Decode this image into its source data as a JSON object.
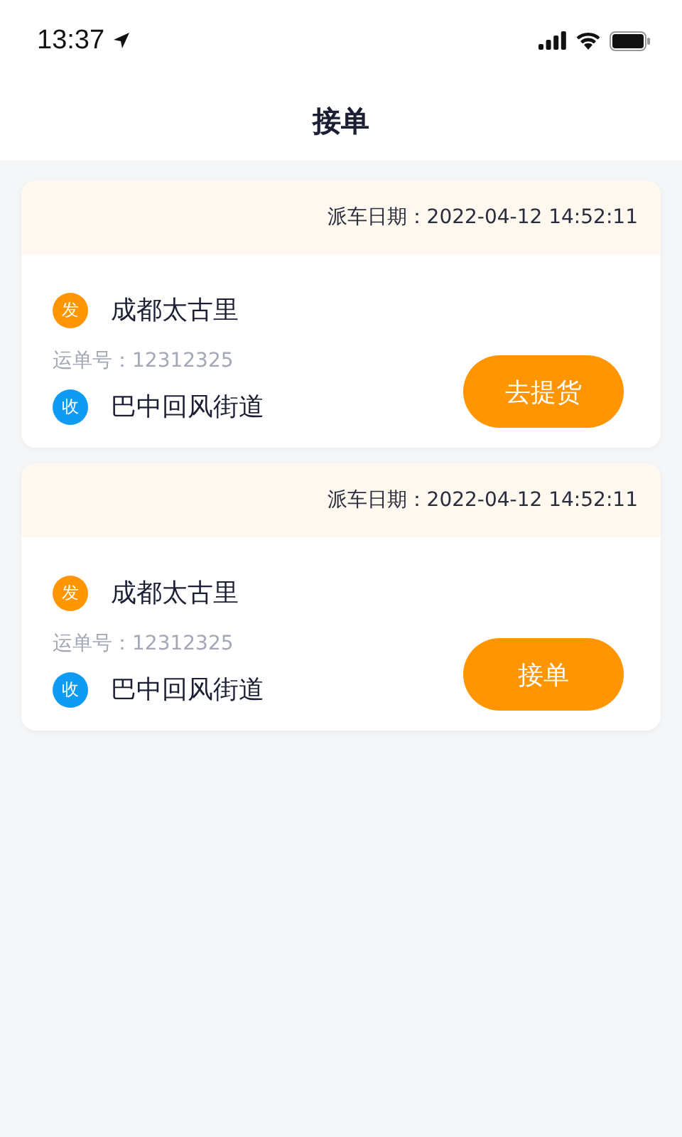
{
  "status_bar": {
    "time": "13:37"
  },
  "nav": {
    "title": "接单"
  },
  "orders": [
    {
      "dispatch_date": "派车日期：2022-04-12 14:52:11",
      "from": {
        "badge": "发",
        "color": "#ff9500",
        "place": "成都太古里"
      },
      "waybill": "运单号：12312325",
      "to": {
        "badge": "收",
        "color": "#0f9bf2",
        "place": "巴中回风街道"
      },
      "action": "去提货"
    },
    {
      "dispatch_date": "派车日期：2022-04-12 14:52:11",
      "from": {
        "badge": "发",
        "color": "#ff9500",
        "place": "成都太古里"
      },
      "waybill": "运单号：12312325",
      "to": {
        "badge": "收",
        "color": "#0f9bf2",
        "place": "巴中回风街道"
      },
      "action": "接单"
    }
  ]
}
